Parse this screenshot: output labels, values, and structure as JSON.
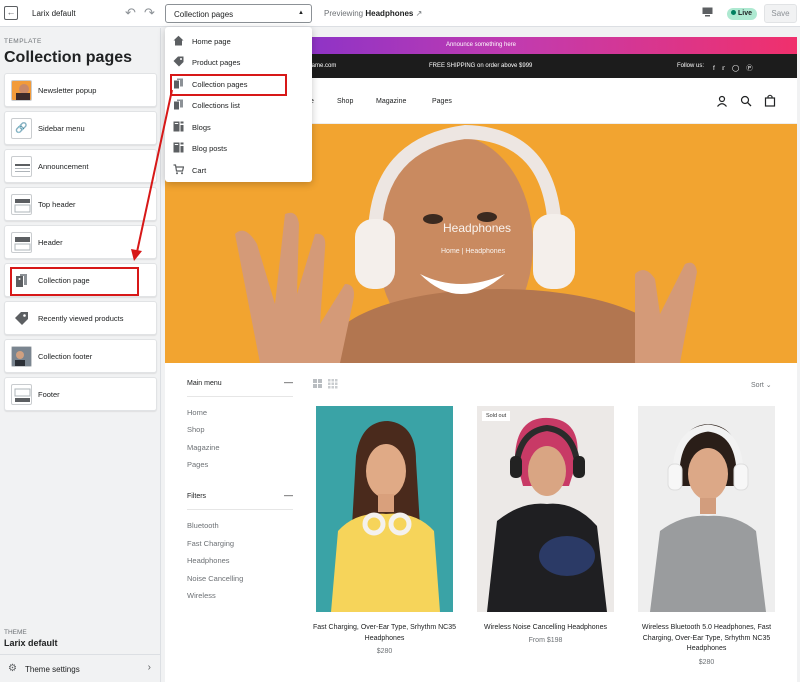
{
  "topbar": {
    "theme_name": "Larix default",
    "page_select": "Collection pages",
    "preview_prefix": "Previewing",
    "preview_product": "Headphones",
    "live_badge": "Live",
    "save_label": "Save"
  },
  "dropdown": {
    "items": [
      {
        "label": "Home page",
        "icon": "home-icon"
      },
      {
        "label": "Product pages",
        "icon": "tag-icon"
      },
      {
        "label": "Collection pages",
        "icon": "collection-icon"
      },
      {
        "label": "Collections list",
        "icon": "collection-icon"
      },
      {
        "label": "Blogs",
        "icon": "blog-icon"
      },
      {
        "label": "Blog posts",
        "icon": "blog-icon"
      },
      {
        "label": "Cart",
        "icon": "cart-icon"
      }
    ]
  },
  "sidebar": {
    "kicker": "TEMPLATE",
    "title": "Collection pages",
    "sections": [
      {
        "label": "Newsletter popup"
      },
      {
        "label": "Sidebar menu"
      },
      {
        "label": "Announcement"
      },
      {
        "label": "Top header"
      },
      {
        "label": "Header"
      },
      {
        "label": "Collection page"
      },
      {
        "label": "Recently viewed products"
      },
      {
        "label": "Collection footer"
      },
      {
        "label": "Footer"
      }
    ],
    "theme_kicker": "THEME",
    "theme_name": "Larix default",
    "theme_settings": "Theme settings"
  },
  "store": {
    "announcement": "Announce something here",
    "email": "ename.com",
    "shipping": "FREE SHIPPING on order above $999",
    "follow": "Follow us:",
    "nav": [
      "e",
      "Shop",
      "Magazine",
      "Pages"
    ],
    "hero_title": "Headphones",
    "hero_crumb": "Home  |  Headphones",
    "main_menu_title": "Main menu",
    "main_menu": [
      "Home",
      "Shop",
      "Magazine",
      "Pages"
    ],
    "filters_title": "Filters",
    "filters": [
      "Bluetooth",
      "Fast Charging",
      "Headphones",
      "Noise Cancelling",
      "Wireless"
    ],
    "sort_label": "Sort",
    "products": [
      {
        "name": "Fast Charging, Over-Ear Type, Srhythm NC35 Headphones",
        "price": "$280",
        "badge": ""
      },
      {
        "name": "Wireless Noise Cancelling Headphones",
        "price": "From $198",
        "badge": "Sold out"
      },
      {
        "name": "Wireless Bluetooth 5.0 Headphones, Fast Charging, Over-Ear Type, Srhythm NC35 Headphones",
        "price": "$280",
        "badge": ""
      }
    ]
  },
  "colors": {
    "annotation_red": "#d71818",
    "hero_bg": "#f2a430",
    "live_green": "#aee9d1"
  }
}
